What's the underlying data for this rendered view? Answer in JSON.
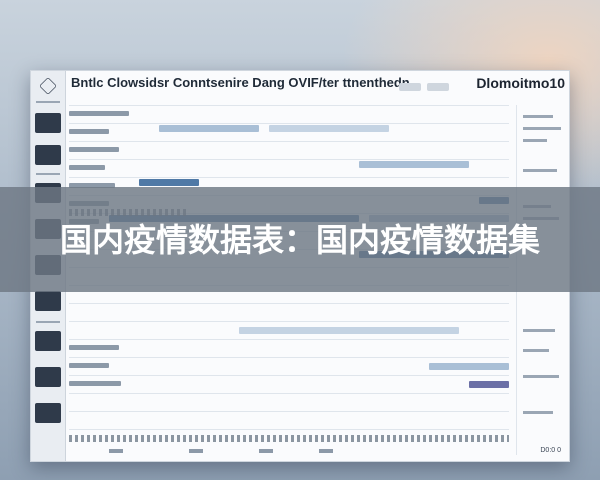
{
  "app": {
    "title": "Bntlc Clowsidsr Conntsenire Dang OVIF/ter ttnenthedn",
    "subtitle": "",
    "brand": "Dlomoitmo10",
    "footer_value": "D0:0 0"
  },
  "overlay": {
    "headline": "国内疫情数据表：国内疫情数据集"
  },
  "colors": {
    "bar_blue": "#4f79a6",
    "bar_light": "#a9bfd6",
    "bar_purple": "#6b6fa6",
    "sidebar_dark": "#2f3a4a"
  }
}
